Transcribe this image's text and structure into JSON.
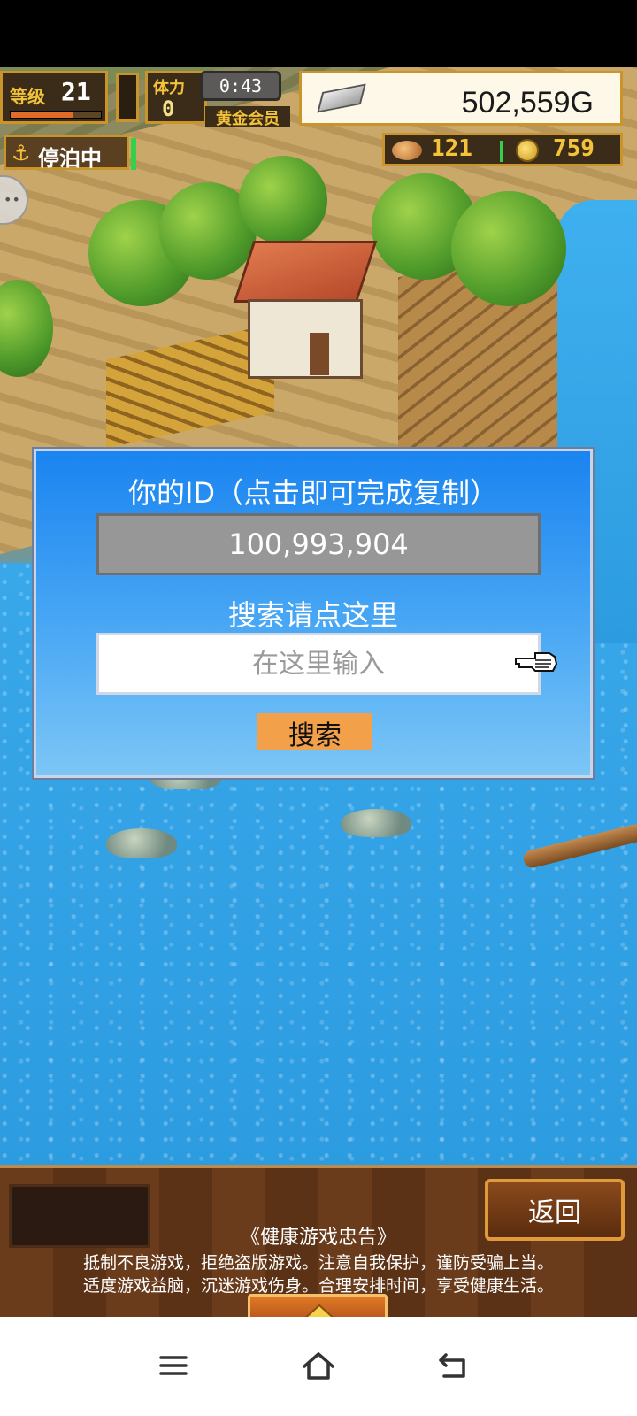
{
  "hud": {
    "level_label": "等级",
    "level_value": "21",
    "level_progress": 0.7,
    "stamina_label": "体力",
    "stamina_value": "0",
    "timer": "0:43",
    "membership": "黄金会员",
    "money": "502,559G",
    "anchor_status": "停泊中",
    "food_count": "121",
    "coin_count": "759",
    "icons": [
      "silver-ingot-icon",
      "anchor-icon",
      "food-icon",
      "coin-icon",
      "chat-icon"
    ]
  },
  "dialog": {
    "id_title": "你的ID（点击即可完成复制）",
    "id_value": "100,993,904",
    "search_title": "搜索请点这里",
    "search_placeholder": "在这里输入",
    "search_value": "",
    "search_button": "搜索"
  },
  "bottom_panel": {
    "return_button": "返回",
    "notice_title": "《健康游戏忠告》",
    "notice_line1": "抵制不良游戏，拒绝盗版游戏。注意自我保护，谨防受骗上当。",
    "notice_line2": "适度游戏益脑，沉迷游戏伤身。合理安排时间，享受健康生活。"
  },
  "navbar": {
    "icons": [
      "menu-icon",
      "home-icon",
      "back-icon"
    ]
  },
  "colors": {
    "dialog_top": "#1a84f0",
    "dialog_bottom": "#7cc6f6",
    "id_box": "#979797",
    "search_button": "#f3a04a",
    "panel_wood": "#6a3c1c",
    "hud_gold": "#c9952a"
  }
}
